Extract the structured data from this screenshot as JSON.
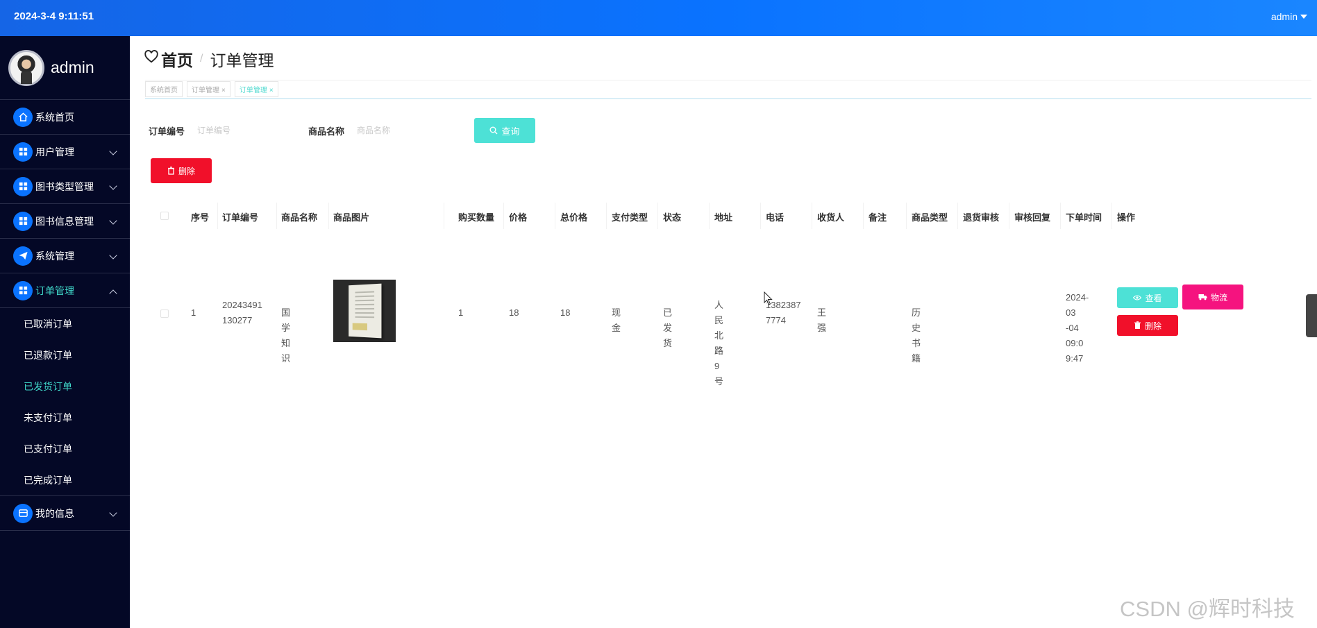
{
  "topbar": {
    "datetime": "2024-3-4 9:11:51",
    "user": "admin"
  },
  "sidebar": {
    "username": "admin",
    "items": [
      {
        "label": "系统首页",
        "icon": "home-icon"
      },
      {
        "label": "用户管理",
        "icon": "grid-icon"
      },
      {
        "label": "图书类型管理",
        "icon": "grid-icon"
      },
      {
        "label": "图书信息管理",
        "icon": "grid-icon"
      },
      {
        "label": "系统管理",
        "icon": "paper-plane-icon"
      },
      {
        "label": "订单管理",
        "icon": "grid-icon"
      },
      {
        "label": "我的信息",
        "icon": "card-icon"
      }
    ],
    "submenu": [
      "已取消订单",
      "已退款订单",
      "已发货订单",
      "未支付订单",
      "已支付订单",
      "已完成订单"
    ]
  },
  "page": {
    "home": "首页",
    "sep": "/",
    "current": "订单管理"
  },
  "tags": [
    {
      "label": "系统首页"
    },
    {
      "label": "订单管理",
      "close": "×"
    },
    {
      "label": "订单管理",
      "close": "×"
    }
  ],
  "search": {
    "order_label": "订单编号",
    "order_placeholder": "订单编号",
    "product_label": "商品名称",
    "product_placeholder": "商品名称",
    "query_label": "查询"
  },
  "delete_label": "删除",
  "table": {
    "headers": [
      "序号",
      "订单编号",
      "商品名称",
      "商品图片",
      "购买数量",
      "价格",
      "总价格",
      "支付类型",
      "状态",
      "地址",
      "电话",
      "收货人",
      "备注",
      "商品类型",
      "退货审核",
      "审核回复",
      "下单时间",
      "操作"
    ],
    "rows": [
      {
        "index": "1",
        "order_no_1": "20243491",
        "order_no_2": "130277",
        "product": "国学知识",
        "qty": "1",
        "price": "18",
        "total": "18",
        "pay_type": "现金",
        "status": "已发货",
        "address_1": "人民北路",
        "address_2": "9号",
        "phone_1": "1382387",
        "phone_2": "7774",
        "receiver": "王强",
        "remark": "",
        "product_type": "历史书籍",
        "return_review": "",
        "review_reply": "",
        "time_1": "2024-03",
        "time_2": "-04 09:0",
        "time_3": "9:47",
        "view_label": "查看",
        "logistics_label": "物流",
        "delete_label": "删除"
      }
    ]
  },
  "watermark": "CSDN @辉时科技",
  "colors": {
    "primary": "#0a73ff",
    "teal": "#4de1d6",
    "red": "#f1102a",
    "pink": "#f5137f",
    "sidebar": "#040826"
  }
}
